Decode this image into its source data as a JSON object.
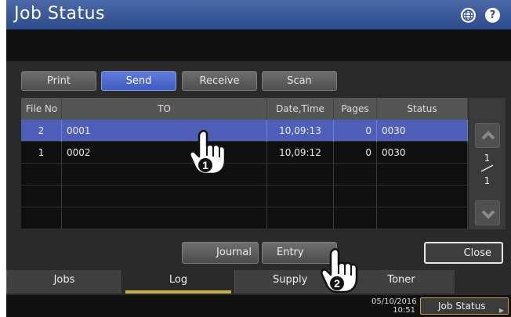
{
  "title": "Job Status",
  "icons": {
    "globe": "globe-icon",
    "help": "help-icon"
  },
  "filters": [
    {
      "label": "Print",
      "active": false
    },
    {
      "label": "Send",
      "active": true
    },
    {
      "label": "Receive",
      "active": false
    },
    {
      "label": "Scan",
      "active": false
    }
  ],
  "table": {
    "columns": [
      "File No",
      "TO",
      "Date,Time",
      "Pages",
      "Status"
    ],
    "rows": [
      {
        "file_no": "2",
        "to": "0001",
        "date_time": "10,09:13",
        "pages": "0",
        "status": "0030",
        "selected": true
      },
      {
        "file_no": "1",
        "to": "0002",
        "date_time": "10,09:12",
        "pages": "0",
        "status": "0030",
        "selected": false
      }
    ],
    "empty_rows": 3
  },
  "pager": {
    "current": "1",
    "total": "1"
  },
  "actions": {
    "journal": "Journal",
    "entry": "Entry",
    "close": "Close"
  },
  "tabs": [
    {
      "label": "Jobs",
      "active": false
    },
    {
      "label": "Log",
      "active": true
    },
    {
      "label": "Supply",
      "active": false
    },
    {
      "label": "Toner",
      "active": false
    }
  ],
  "status_bar": {
    "date": "05/10/2016",
    "time": "10:51",
    "job_status_label": "Job Status"
  },
  "callouts": [
    "1",
    "2"
  ],
  "colors": {
    "title_bar": "#3a5898",
    "selected_row": "#4d5fb8",
    "active_button": "#4a68d0",
    "tab_underline": "#c8b04a"
  }
}
